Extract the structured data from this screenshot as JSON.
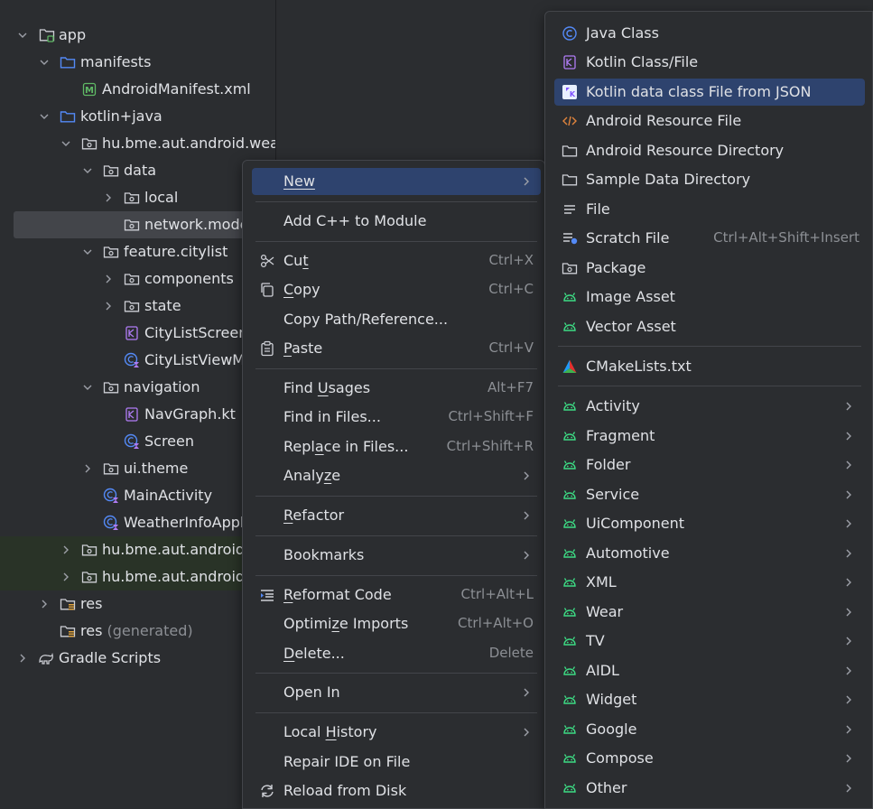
{
  "tree": {
    "items": [
      {
        "label": "app"
      },
      {
        "label": "manifests"
      },
      {
        "label": "AndroidManifest.xml"
      },
      {
        "label": "kotlin+java"
      },
      {
        "label": "hu.bme.aut.android.weath"
      },
      {
        "label": "data"
      },
      {
        "label": "local"
      },
      {
        "label": "network.mode"
      },
      {
        "label": "feature.citylist"
      },
      {
        "label": "components"
      },
      {
        "label": "state"
      },
      {
        "label": "CityListScreen"
      },
      {
        "label": "CityListViewM"
      },
      {
        "label": "navigation"
      },
      {
        "label": "NavGraph.kt"
      },
      {
        "label": "Screen"
      },
      {
        "label": "ui.theme"
      },
      {
        "label": "MainActivity"
      },
      {
        "label": "WeatherInfoAppli"
      },
      {
        "label": "hu.bme.aut.android.w"
      },
      {
        "label": "hu.bme.aut.android.w"
      },
      {
        "label": "res"
      },
      {
        "label": "res",
        "suffix": "(generated)"
      },
      {
        "label": "Gradle Scripts"
      }
    ]
  },
  "context_menu": {
    "new": {
      "label": "New"
    },
    "add_cpp": {
      "label": "Add C++ to Module"
    },
    "cut": {
      "pre": "Cu",
      "u": "t",
      "post": "",
      "shortcut": "Ctrl+X"
    },
    "copy": {
      "pre": "",
      "u": "C",
      "post": "opy",
      "shortcut": "Ctrl+C"
    },
    "copy_path": {
      "label": "Copy Path/Reference..."
    },
    "paste": {
      "pre": "",
      "u": "P",
      "post": "aste",
      "shortcut": "Ctrl+V"
    },
    "find_usages": {
      "pre": "Find ",
      "u": "U",
      "post": "sages",
      "shortcut": "Alt+F7"
    },
    "find_in_files": {
      "label": "Find in Files...",
      "shortcut": "Ctrl+Shift+F"
    },
    "replace_in_files": {
      "pre": "Repl",
      "u": "a",
      "post": "ce in Files...",
      "shortcut": "Ctrl+Shift+R"
    },
    "analyze": {
      "pre": "Analy",
      "u": "z",
      "post": "e"
    },
    "refactor": {
      "pre": "",
      "u": "R",
      "post": "efactor"
    },
    "bookmarks": {
      "label": "Bookmarks"
    },
    "reformat": {
      "pre": "",
      "u": "R",
      "post": "eformat Code",
      "shortcut": "Ctrl+Alt+L"
    },
    "optimize": {
      "pre": "Optimi",
      "u": "z",
      "post": "e Imports",
      "shortcut": "Ctrl+Alt+O"
    },
    "delete": {
      "pre": "",
      "u": "D",
      "post": "elete...",
      "shortcut": "Delete"
    },
    "open_in": {
      "label": "Open In"
    },
    "local_history": {
      "pre": "Local ",
      "u": "H",
      "post": "istory"
    },
    "repair_ide": {
      "label": "Repair IDE on File"
    },
    "reload": {
      "label": "Reload from Disk"
    }
  },
  "submenu": {
    "java_class": "Java Class",
    "kotlin_class": "Kotlin Class/File",
    "kotlin_json": "Kotlin data class File from JSON",
    "android_resource_file": "Android Resource File",
    "android_resource_dir": "Android Resource Directory",
    "sample_data_dir": "Sample Data Directory",
    "file": "File",
    "scratch_file": {
      "label": "Scratch File",
      "shortcut": "Ctrl+Alt+Shift+Insert"
    },
    "package": "Package",
    "image_asset": "Image Asset",
    "vector_asset": "Vector Asset",
    "cmakelists": "CMakeLists.txt",
    "groups": [
      {
        "label": "Activity"
      },
      {
        "label": "Fragment"
      },
      {
        "label": "Folder"
      },
      {
        "label": "Service"
      },
      {
        "label": "UiComponent"
      },
      {
        "label": "Automotive"
      },
      {
        "label": "XML"
      },
      {
        "label": "Wear"
      },
      {
        "label": "TV"
      },
      {
        "label": "AIDL"
      },
      {
        "label": "Widget"
      },
      {
        "label": "Google"
      },
      {
        "label": "Compose"
      },
      {
        "label": "Other"
      }
    ]
  },
  "colors": {
    "background": "#2b2d30",
    "selection": "#2e436e",
    "android_green": "#3ddc84",
    "folder_blue": "#548af7",
    "kotlin_purple": "#b07cf5"
  }
}
